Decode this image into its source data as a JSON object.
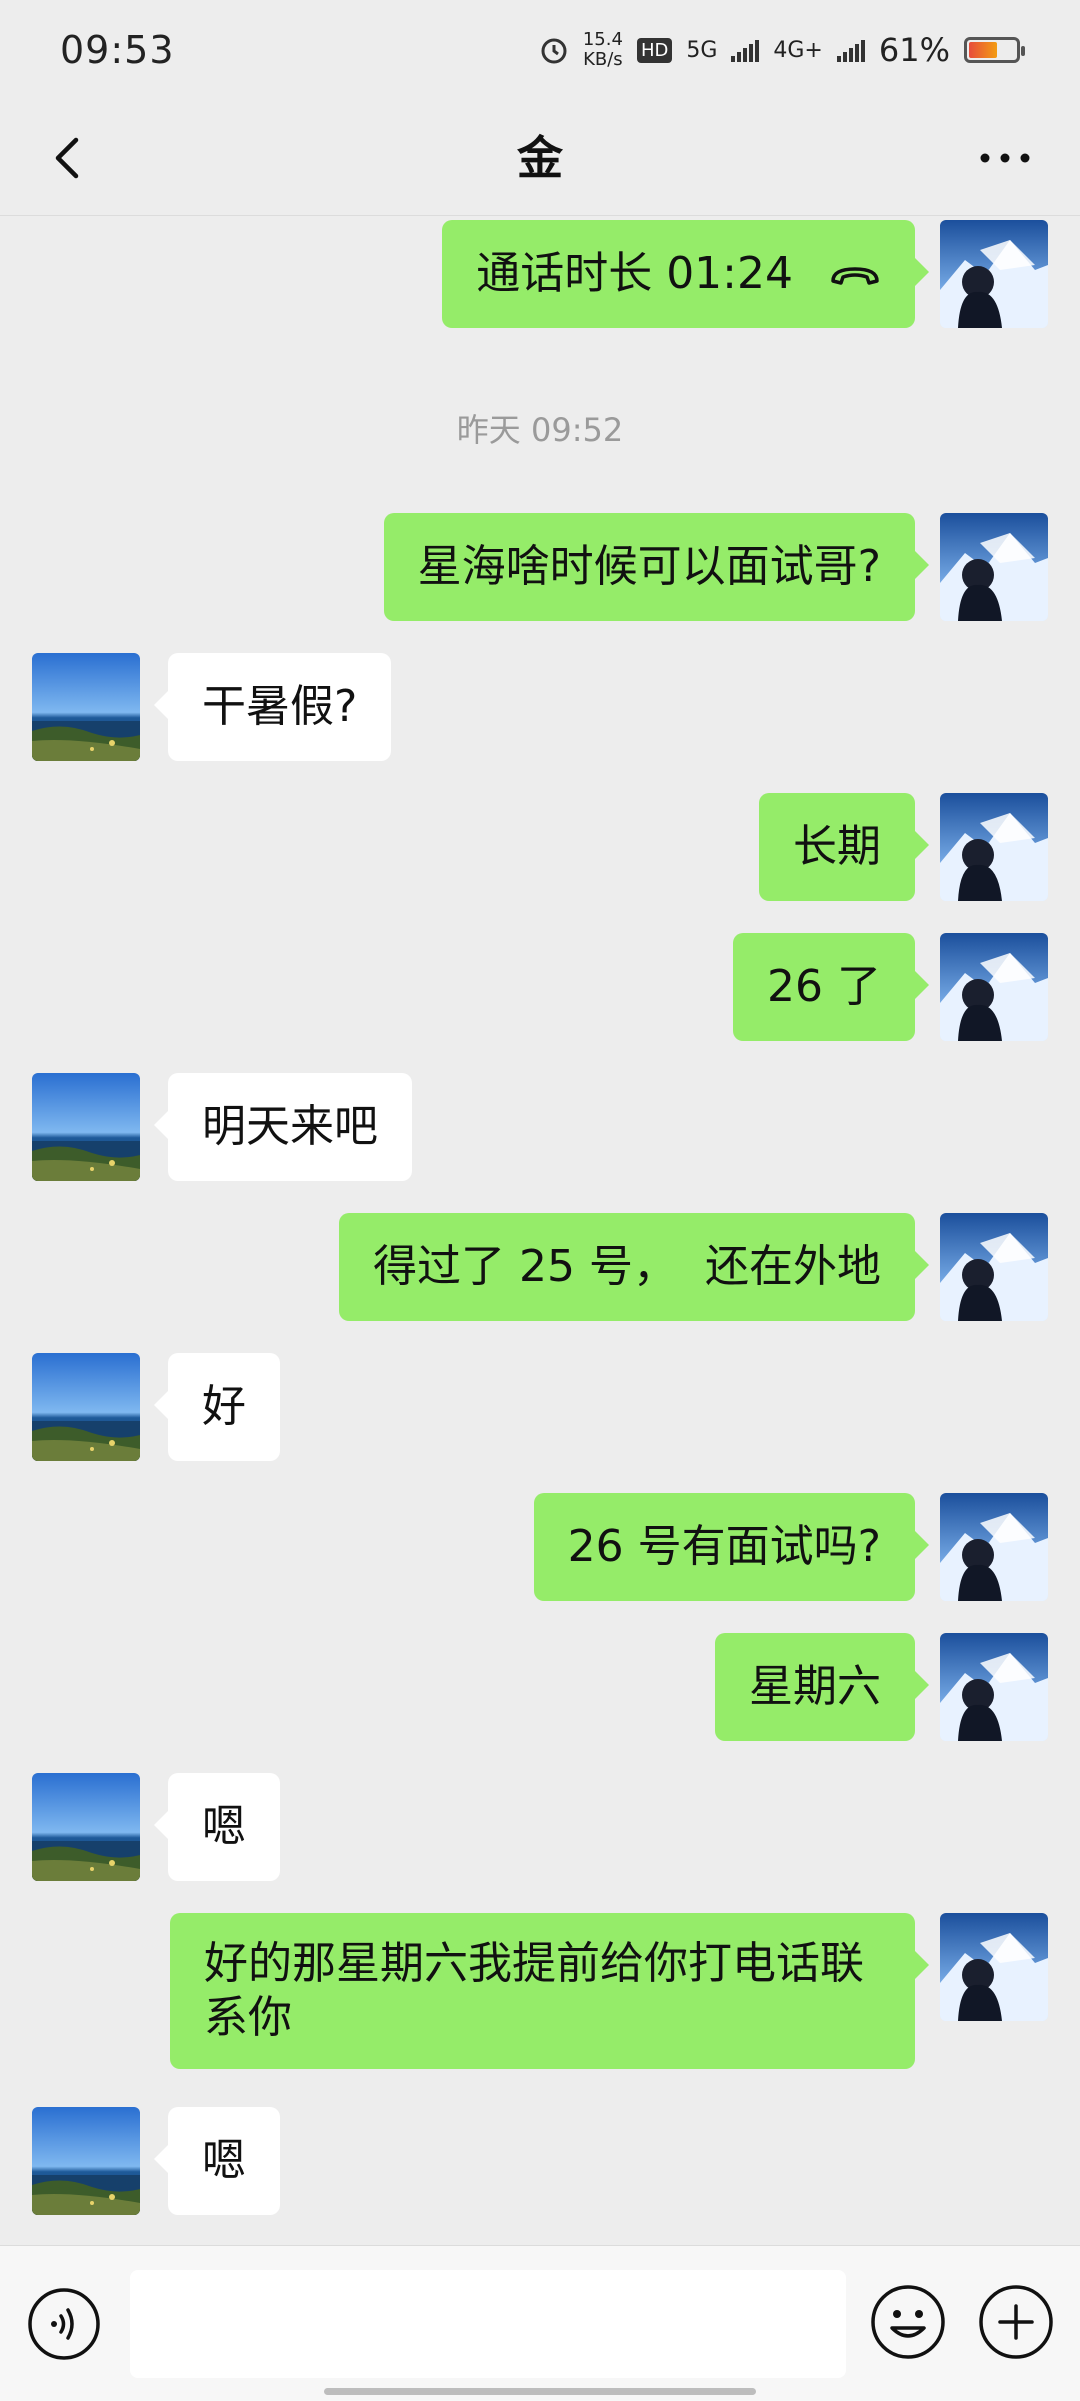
{
  "status_bar": {
    "time": "09:53",
    "speed_value": "15.4",
    "speed_unit": "KB/s",
    "hd_label": "HD",
    "net1": "5G",
    "net2": "4G+",
    "battery_pct": "61%",
    "battery_level": 0.61,
    "icons": [
      "alarm-icon",
      "hd-icon",
      "signal-icon",
      "signal-icon",
      "battery-icon"
    ]
  },
  "header": {
    "title": "金",
    "back_icon": "chevron-left-icon",
    "more_icon": "more-dots-icon"
  },
  "messages": [
    {
      "sender": "me",
      "type": "call",
      "text": "通话时长 01:24"
    },
    {
      "type": "timestamp",
      "text": "昨天 09:52"
    },
    {
      "sender": "me",
      "text": "星海啥时候可以面试哥?"
    },
    {
      "sender": "peer",
      "text": "干暑假?"
    },
    {
      "sender": "me",
      "text": "长期"
    },
    {
      "sender": "me",
      "text": "26 了"
    },
    {
      "sender": "peer",
      "text": "明天来吧"
    },
    {
      "sender": "me",
      "text": "得过了 25 号，  还在外地"
    },
    {
      "sender": "peer",
      "text": "好"
    },
    {
      "sender": "me",
      "text": "26 号有面试吗?"
    },
    {
      "sender": "me",
      "text": "星期六"
    },
    {
      "sender": "peer",
      "text": "嗯"
    },
    {
      "sender": "me",
      "text": "好的那星期六我提前给你打电话联系你"
    },
    {
      "sender": "peer",
      "text": "嗯"
    }
  ],
  "input_bar": {
    "placeholder": "",
    "voice_icon": "voice-icon",
    "emoji_icon": "emoji-icon",
    "plus_icon": "plus-icon"
  },
  "colors": {
    "my_bubble": "#95ec69",
    "peer_bubble": "#ffffff",
    "background": "#ededed"
  }
}
